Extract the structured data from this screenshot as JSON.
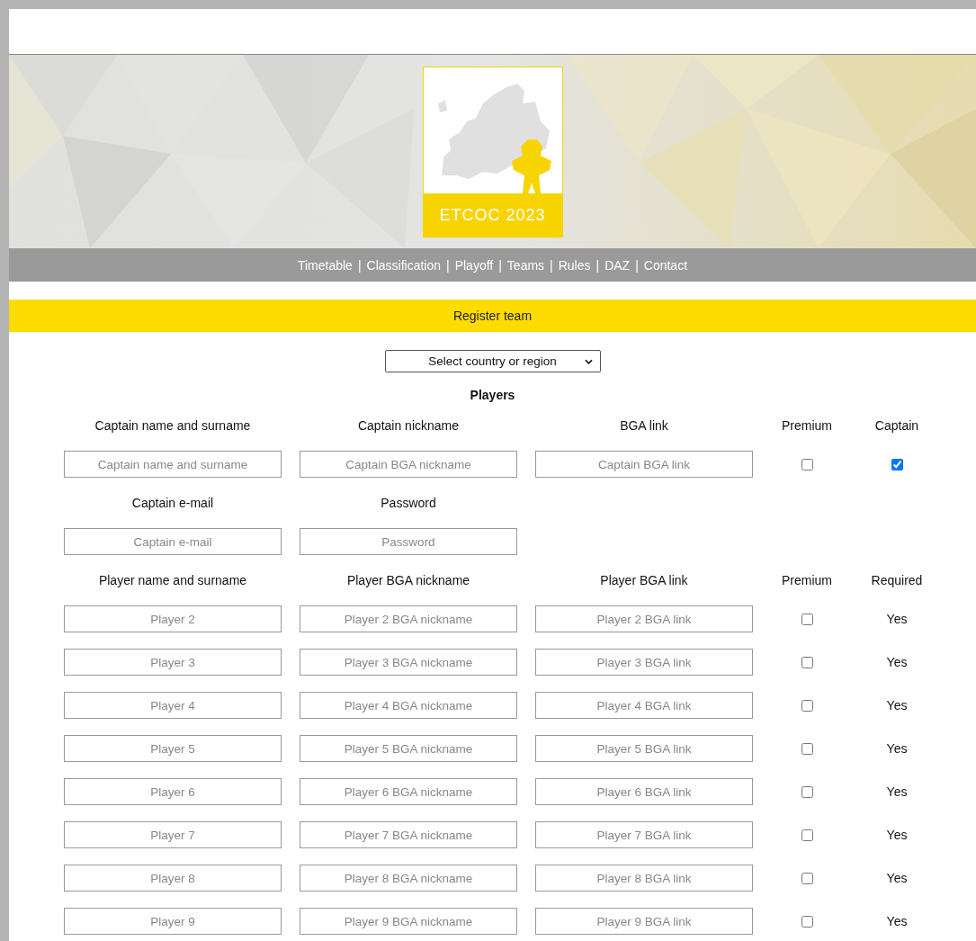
{
  "banner": {
    "logo_text": "ETCOC 2023"
  },
  "nav": [
    {
      "label": "Timetable",
      "separator": "|"
    },
    {
      "label": "Classification",
      "separator": "|"
    },
    {
      "label": "Playoff",
      "separator": "|"
    },
    {
      "label": "Teams",
      "separator": "|"
    },
    {
      "label": "Rules",
      "separator": "|"
    },
    {
      "label": "DAZ",
      "separator": "|"
    },
    {
      "label": "Contact"
    }
  ],
  "section_title": "Register team",
  "country_select": {
    "value": "Select country or region"
  },
  "players_heading": "Players",
  "captain": {
    "headers": [
      "Captain name and surname",
      "Captain nickname",
      "BGA link",
      "Premium",
      "Captain"
    ],
    "fields": [
      {
        "placeholder": "Captain name and surname"
      },
      {
        "placeholder": "Captain BGA nickname"
      },
      {
        "placeholder": "Captain BGA link"
      }
    ],
    "premium": {
      "checked": false
    },
    "captain": {
      "checked": true
    },
    "headers_2": [
      "Captain e-mail",
      "Password"
    ],
    "fields_2": [
      {
        "placeholder": "Captain e-mail"
      },
      {
        "placeholder": "Password"
      }
    ]
  },
  "player_headers": [
    "Player name and surname",
    "Player BGA nickname",
    "Player BGA link",
    "Premium",
    "Required"
  ],
  "players": [
    {
      "fields": [
        {
          "placeholder": "Player 2"
        },
        {
          "placeholder": "Player 2 BGA nickname"
        },
        {
          "placeholder": "Player 2 BGA link"
        }
      ],
      "premium": false,
      "required": "Yes"
    },
    {
      "fields": [
        {
          "placeholder": "Player 3"
        },
        {
          "placeholder": "Player 3 BGA nickname"
        },
        {
          "placeholder": "Player 3 BGA link"
        }
      ],
      "premium": false,
      "required": "Yes"
    },
    {
      "fields": [
        {
          "placeholder": "Player 4"
        },
        {
          "placeholder": "Player 4 BGA nickname"
        },
        {
          "placeholder": "Player 4 BGA link"
        }
      ],
      "premium": false,
      "required": "Yes"
    },
    {
      "fields": [
        {
          "placeholder": "Player 5"
        },
        {
          "placeholder": "Player 5 BGA nickname"
        },
        {
          "placeholder": "Player 5 BGA link"
        }
      ],
      "premium": false,
      "required": "Yes"
    },
    {
      "fields": [
        {
          "placeholder": "Player 6"
        },
        {
          "placeholder": "Player 6 BGA nickname"
        },
        {
          "placeholder": "Player 6 BGA link"
        }
      ],
      "premium": false,
      "required": "Yes"
    },
    {
      "fields": [
        {
          "placeholder": "Player 7"
        },
        {
          "placeholder": "Player 7 BGA nickname"
        },
        {
          "placeholder": "Player 7 BGA link"
        }
      ],
      "premium": false,
      "required": "Yes"
    },
    {
      "fields": [
        {
          "placeholder": "Player 8"
        },
        {
          "placeholder": "Player 8 BGA nickname"
        },
        {
          "placeholder": "Player 8 BGA link"
        }
      ],
      "premium": false,
      "required": "Yes"
    },
    {
      "fields": [
        {
          "placeholder": "Player 9"
        },
        {
          "placeholder": "Player 9 BGA nickname"
        },
        {
          "placeholder": "Player 9 BGA link"
        }
      ],
      "premium": false,
      "required": "Yes"
    }
  ]
}
